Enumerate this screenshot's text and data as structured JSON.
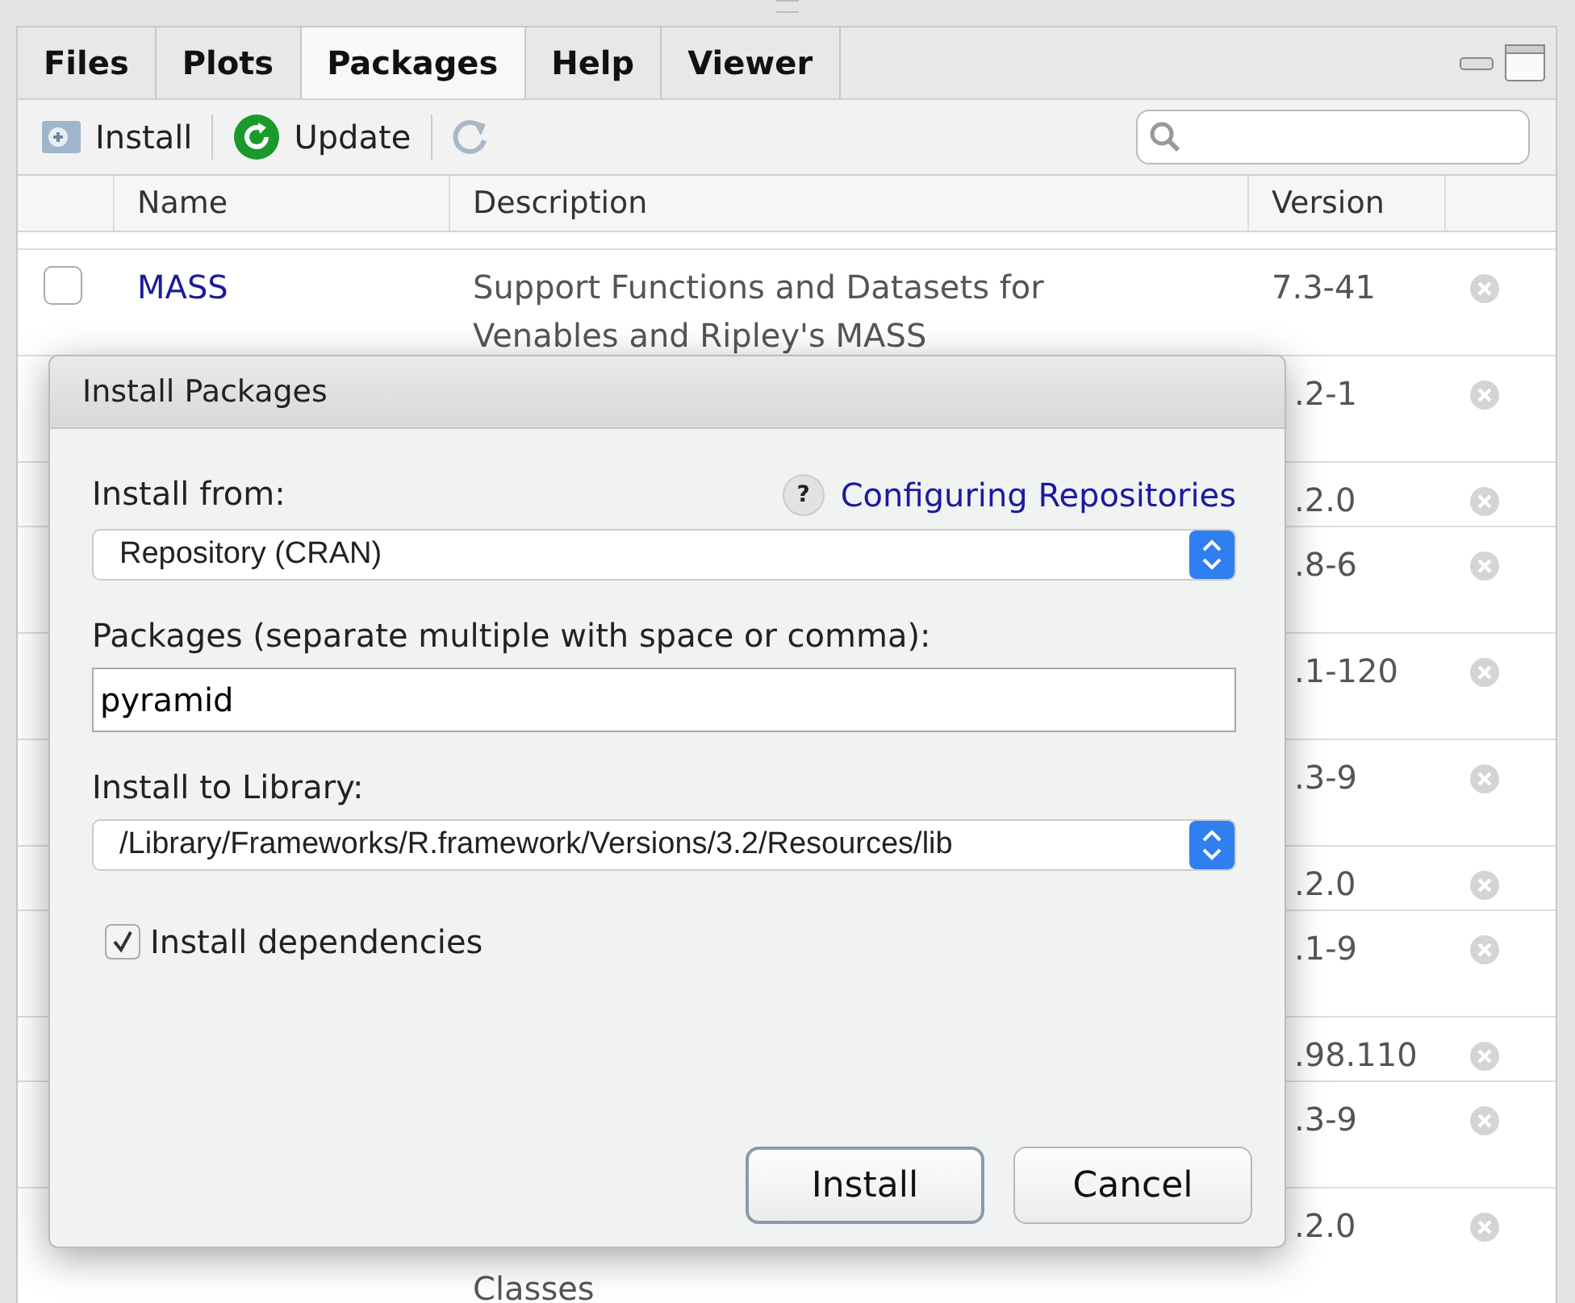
{
  "tabs": [
    {
      "label": "Files",
      "selected": false
    },
    {
      "label": "Plots",
      "selected": false
    },
    {
      "label": "Packages",
      "selected": true
    },
    {
      "label": "Help",
      "selected": false
    },
    {
      "label": "Viewer",
      "selected": false
    }
  ],
  "toolbar": {
    "install": "Install",
    "update": "Update"
  },
  "table": {
    "columns": [
      "Name",
      "Description",
      "Version"
    ],
    "rows": [
      {
        "name": "MASS",
        "description": "Support Functions and Datasets for Venables and Ripley's MASS",
        "version": "7.3-41",
        "checked": false
      },
      {
        "version": ".2-1"
      },
      {
        "version": ".2.0"
      },
      {
        "version": ".8-6"
      },
      {
        "version": ".1-120"
      },
      {
        "version": ".3-9"
      },
      {
        "version": ".2.0"
      },
      {
        "version": ".1-9"
      },
      {
        "version": ".98.110"
      },
      {
        "version": ".3-9"
      },
      {
        "version": ".2.0",
        "description": "Classes"
      }
    ]
  },
  "dialog": {
    "title": "Install Packages",
    "install_from_label": "Install from:",
    "help_icon": "?",
    "help_link": "Configuring Repositories",
    "install_from": "Repository (CRAN)",
    "packages_label": "Packages (separate multiple with space or comma):",
    "packages": "pyramid",
    "library_label": "Install to Library:",
    "library": "/Library/Frameworks/R.framework/Versions/3.2/Resources/lib",
    "dependencies": {
      "label": "Install dependencies",
      "checked": true
    },
    "buttons": [
      "Install",
      "Cancel"
    ]
  }
}
